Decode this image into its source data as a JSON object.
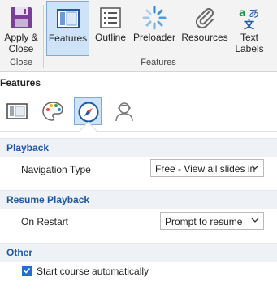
{
  "ribbon": {
    "buttons": [
      {
        "id": "apply-close",
        "label_line1": "Apply &",
        "label_line2": "Close"
      },
      {
        "id": "features",
        "label": "Features"
      },
      {
        "id": "outline",
        "label": "Outline"
      },
      {
        "id": "preloader",
        "label": "Preloader"
      },
      {
        "id": "resources",
        "label": "Resources"
      },
      {
        "id": "text-labels",
        "label_line1": "Text",
        "label_line2": "Labels"
      }
    ],
    "groups": {
      "close": "Close",
      "features": "Features"
    }
  },
  "panel": {
    "title": "Features",
    "tabs": [
      {
        "icon": "player-layout-icon"
      },
      {
        "icon": "palette-icon"
      },
      {
        "icon": "compass-icon",
        "active": true
      },
      {
        "icon": "presenter-icon"
      }
    ]
  },
  "playback": {
    "heading": "Playback",
    "navigation_type_label": "Navigation Type",
    "navigation_type_value": "Free - View all slides in"
  },
  "resume": {
    "heading": "Resume Playback",
    "on_restart_label": "On Restart",
    "on_restart_value": "Prompt to resume"
  },
  "other": {
    "heading": "Other",
    "start_automatically_label": "Start course automatically",
    "start_automatically_checked": true
  },
  "colors": {
    "accent": "#1f57a5",
    "active_bg": "#cfe3f8",
    "section_bg": "#eef2f7"
  }
}
